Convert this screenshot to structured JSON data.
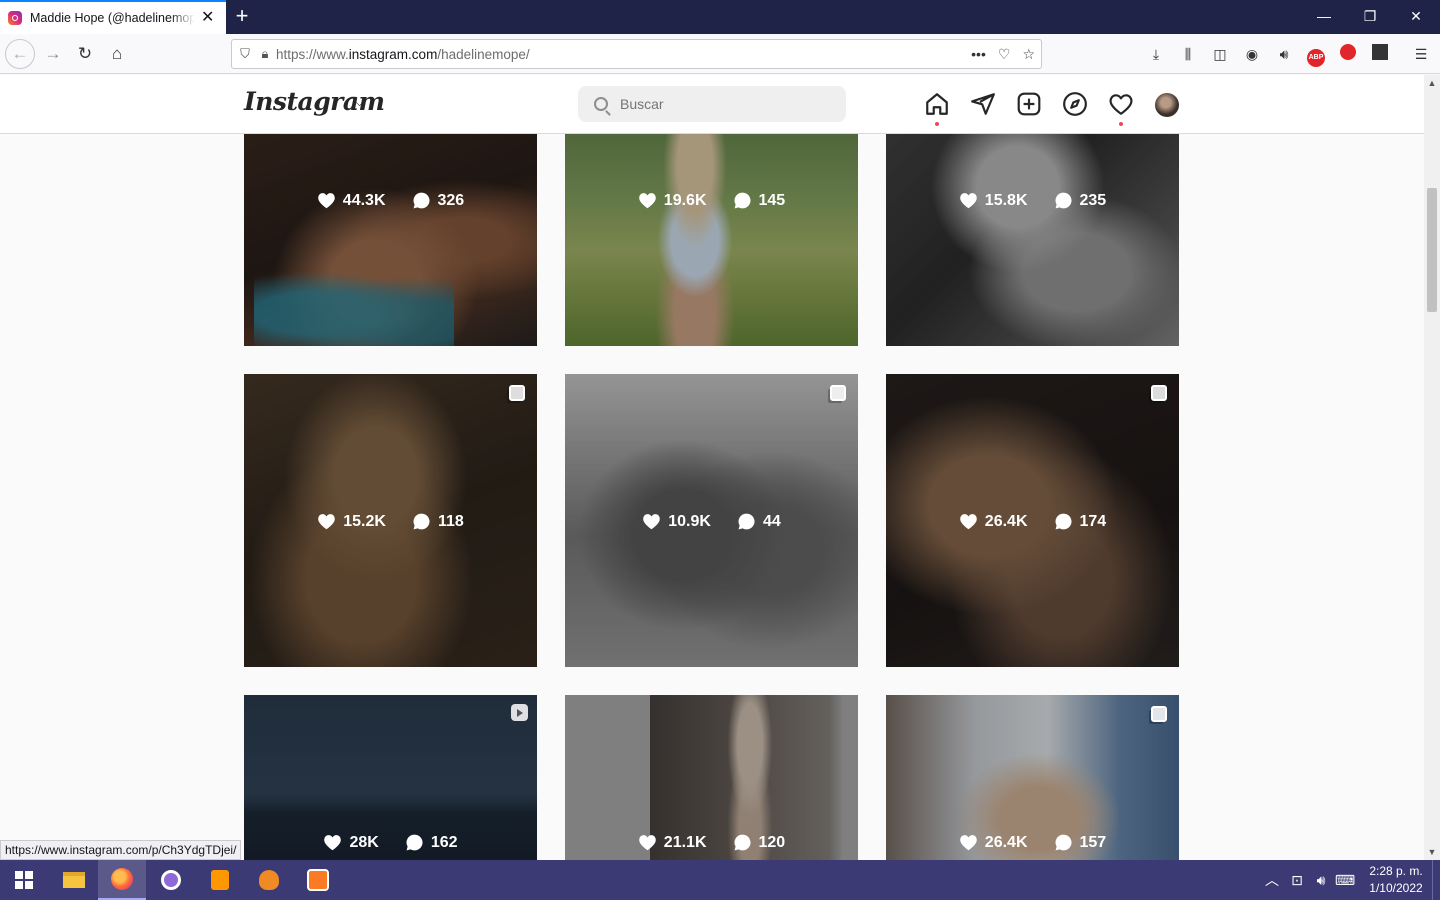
{
  "browser": {
    "tab_title": "Maddie Hope (@hadelinemope) • Instagram",
    "new_tab": "+",
    "url_prefix": "https://www.",
    "url_domain": "instagram.com",
    "url_path": "/hadelinemope/",
    "url_more": "•••",
    "status_link": "https://www.instagram.com/p/Ch3YdgTDjei/"
  },
  "instagram": {
    "logo": "Instagram",
    "search_placeholder": "Buscar",
    "nav_icons": [
      "home-icon",
      "direct-message-icon",
      "new-post-icon",
      "explore-icon",
      "activity-heart-icon",
      "profile-avatar"
    ]
  },
  "posts": [
    {
      "likes": "44.3K",
      "comments": "326",
      "badge": "none",
      "palette": "warm-dark"
    },
    {
      "likes": "19.6K",
      "comments": "145",
      "badge": "none",
      "palette": "sunny-green"
    },
    {
      "likes": "15.8K",
      "comments": "235",
      "badge": "none",
      "palette": "grayscale"
    },
    {
      "likes": "15.2K",
      "comments": "118",
      "badge": "carousel",
      "palette": "dim-bronze"
    },
    {
      "likes": "10.9K",
      "comments": "44",
      "badge": "carousel",
      "palette": "grayscale-boat"
    },
    {
      "likes": "26.4K",
      "comments": "174",
      "badge": "carousel",
      "palette": "dark-room"
    },
    {
      "likes": "28K",
      "comments": "162",
      "badge": "reel",
      "palette": "ocean"
    },
    {
      "likes": "21.1K",
      "comments": "120",
      "badge": "none",
      "palette": "doorway"
    },
    {
      "likes": "26.4K",
      "comments": "157",
      "badge": "carousel",
      "palette": "bright-room"
    }
  ],
  "taskbar": {
    "clock_time": "2:28 p. m.",
    "clock_date": "1/10/2022"
  },
  "colors": {
    "tabbar": "#1f2347",
    "taskbar": "#3c3a74",
    "notification_dot": "#ed4956"
  }
}
